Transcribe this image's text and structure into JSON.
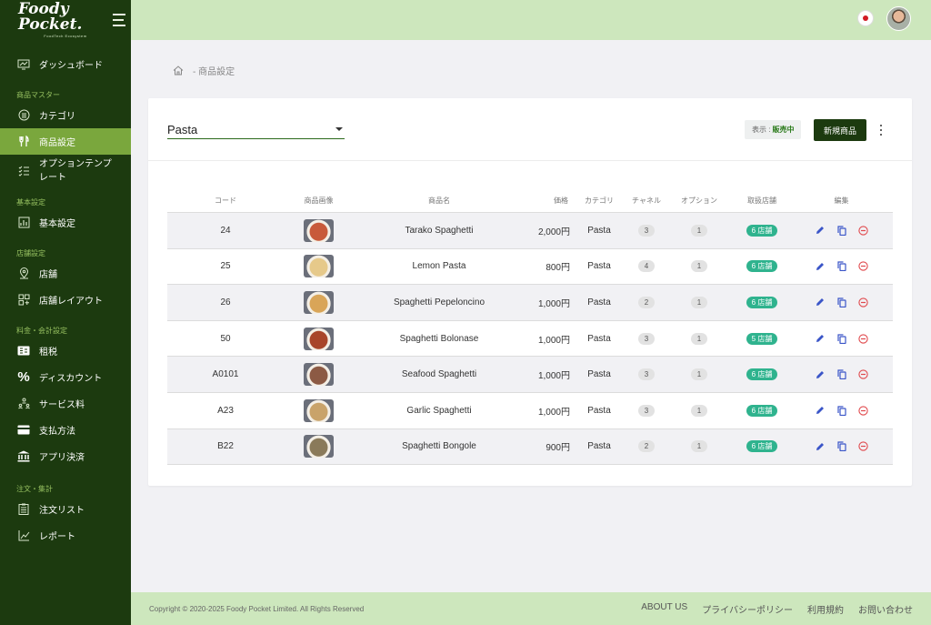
{
  "brand": {
    "name": "Foody Pocket.",
    "tagline": "FoodTech Ecosystem"
  },
  "sidebar": {
    "dashboard": "ダッシュボード",
    "sections": {
      "products": "商品マスター",
      "basic": "基本設定",
      "stores": "店舗設定",
      "fees": "料金・会計設定",
      "orders": "注文・集計"
    },
    "items": {
      "category": "カテゴリ",
      "product_settings": "商品設定",
      "option_template": "オプションテンプレート",
      "basic_settings": "基本設定",
      "store": "店舗",
      "store_layout": "店舗レイアウト",
      "tax": "租税",
      "discount": "ディスカウント",
      "service_fee": "サービス料",
      "payment": "支払方法",
      "app_payment": "アプリ決済",
      "order_list": "注文リスト",
      "report": "レポート"
    }
  },
  "breadcrumb": "- 商品設定",
  "toolbar": {
    "category_value": "Pasta",
    "display_label": "表示 :",
    "display_value": "販売中",
    "new_button": "新規商品"
  },
  "table": {
    "headers": {
      "code": "コード",
      "image": "商品画像",
      "name": "商品名",
      "price": "価格",
      "category": "カテゴリ",
      "channel": "チャネル",
      "option": "オプション",
      "stores": "取扱店舗",
      "edit": "編集"
    },
    "rows": [
      {
        "code": "24",
        "name": "Tarako Spaghetti",
        "price": "2,000円",
        "category": "Pasta",
        "channel": "3",
        "option": "1",
        "stores": "6 店舗",
        "img_color": "#c85a3a"
      },
      {
        "code": "25",
        "name": "Lemon Pasta",
        "price": "800円",
        "category": "Pasta",
        "channel": "4",
        "option": "1",
        "stores": "6 店舗",
        "img_color": "#e6c98a"
      },
      {
        "code": "26",
        "name": "Spaghetti Pepeloncino",
        "price": "1,000円",
        "category": "Pasta",
        "channel": "2",
        "option": "1",
        "stores": "6 店舗",
        "img_color": "#d9a558"
      },
      {
        "code": "50",
        "name": "Spaghetti Bolonase",
        "price": "1,000円",
        "category": "Pasta",
        "channel": "3",
        "option": "1",
        "stores": "5 店舗",
        "img_color": "#a8452a"
      },
      {
        "code": "A0101",
        "name": "Seafood Spaghetti",
        "price": "1,000円",
        "category": "Pasta",
        "channel": "3",
        "option": "1",
        "stores": "6 店舗",
        "img_color": "#8c5a44"
      },
      {
        "code": "A23",
        "name": "Garlic Spaghetti",
        "price": "1,000円",
        "category": "Pasta",
        "channel": "3",
        "option": "1",
        "stores": "6 店舗",
        "img_color": "#c9a36a"
      },
      {
        "code": "B22",
        "name": "Spaghetti Bongole",
        "price": "900円",
        "category": "Pasta",
        "channel": "2",
        "option": "1",
        "stores": "6 店舗",
        "img_color": "#8a7a5a"
      }
    ]
  },
  "footer": {
    "copyright": "Copyright © 2020-2025 Foody Pocket Limited. All Rights Reserved",
    "links": [
      "ABOUT US",
      "プライバシーポリシー",
      "利用規約",
      "お問い合わせ"
    ]
  },
  "colors": {
    "sidebar": "#1c3a0f",
    "accent": "#7aa73d",
    "topbar": "#cde7bd",
    "badge": "#2fb38e"
  }
}
